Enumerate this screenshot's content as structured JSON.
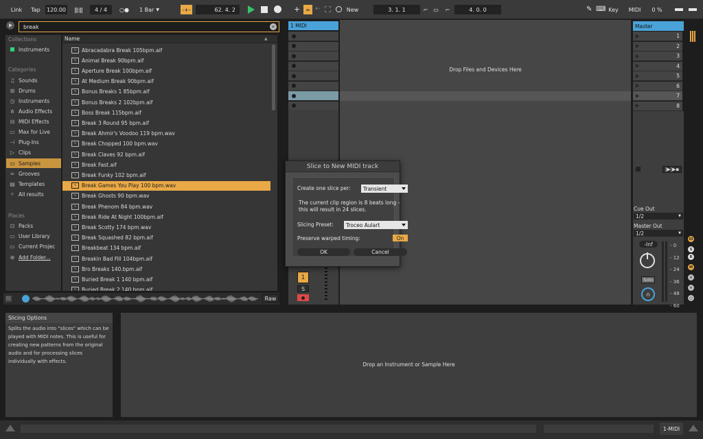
{
  "transport": {
    "link": "Link",
    "tap": "Tap",
    "tempo": "120.00",
    "meter_icon": "metronome-bars-icon",
    "time_signature": "4 / 4",
    "follow": "○●",
    "quantize": "1 Bar",
    "position": "62.  4.  2",
    "new": "New",
    "loop_start": "3.  1.  1",
    "loop_length": "4.  0.  0",
    "key": "Key",
    "midi": "MIDI",
    "cpu": "0 %"
  },
  "browser": {
    "search_value": "break",
    "collections_heading": "Collections",
    "collections": [
      {
        "label": "Instruments",
        "color": "#2fd47a"
      }
    ],
    "categories_heading": "Categories",
    "categories": [
      {
        "label": "Sounds",
        "icon": "note-icon"
      },
      {
        "label": "Drums",
        "icon": "drums-icon"
      },
      {
        "label": "Instruments",
        "icon": "clock-icon"
      },
      {
        "label": "Audio Effects",
        "icon": "audio-fx-icon"
      },
      {
        "label": "MIDI Effects",
        "icon": "midi-fx-icon"
      },
      {
        "label": "Max for Live",
        "icon": "max-icon"
      },
      {
        "label": "Plug-Ins",
        "icon": "plugin-icon"
      },
      {
        "label": "Clips",
        "icon": "clip-icon"
      },
      {
        "label": "Samples",
        "icon": "sample-icon"
      },
      {
        "label": "Grooves",
        "icon": "groove-icon"
      },
      {
        "label": "Templates",
        "icon": "template-icon"
      },
      {
        "label": "All results",
        "icon": "search-icon"
      }
    ],
    "places_heading": "Places",
    "places": [
      {
        "label": "Packs",
        "icon": "packs-icon"
      },
      {
        "label": "User Library",
        "icon": "user-icon"
      },
      {
        "label": "Current Projec",
        "icon": "project-icon"
      },
      {
        "label": "Add Folder...",
        "icon": "add-folder-icon"
      }
    ],
    "name_header": "Name",
    "files": [
      "Abracadabra Break 105bpm.aif",
      "Animal Break 90bpm.aif",
      "Aperture Break 100bpm.aif",
      "At Medium Break 90bpm.aif",
      "Bonus Breaks 1 85bpm.aif",
      "Bonus Breaks 2 102bpm.aif",
      "Boss Break 115bpm.aif",
      "Break 3 Round 95 bpm.aif",
      "Break Ahmir's Voodoo 119 bpm.wav",
      "Break Chopped 100 bpm.wav",
      "Break Claves 92 bpm.aif",
      "Break Fast.aif",
      "Break Funky 102 bpm.aif",
      "Break Games You Play 100 bpm.wav",
      "Break Ghosts 90 bpm.wav",
      "Break Phenom 84 bpm.wav",
      "Break Ride At Night 100bpm.aif",
      "Break Scotty 174 bpm.wav",
      "Break Squashed 82 bpm.aif",
      "Breakbeat 134 bpm.aif",
      "Breakin Bad Fill 104bpm.aif",
      "Bro Breaks 140.bpm.aif",
      "Buried Break 1 140 bpm.aif",
      "Buried Break 2 140 bpm.aif"
    ],
    "selected_file_index": 13,
    "preview_raw": "Raw"
  },
  "session": {
    "track_name": "1 MIDI",
    "drop_hint": "Drop Files and Devices Here",
    "track_number": "1",
    "solo": "S",
    "master_name": "Master",
    "scenes": [
      "1",
      "2",
      "3",
      "4",
      "5",
      "6",
      "7",
      "8"
    ],
    "cue_out_label": "Cue Out",
    "cue_out_value": "1/2",
    "master_out_label": "Master Out",
    "master_out_value": "1/2",
    "volume": "-Inf",
    "solo_label": "Solo",
    "meter_ticks": [
      "0",
      "12",
      "24",
      "36",
      "48",
      "60"
    ]
  },
  "info": {
    "title": "Slicing Options",
    "text": "Splits the audio into \"slices\" which can be played with MIDI notes. This is useful for creating new patterns from the original audio and for processing slices individually with effects."
  },
  "device": {
    "drop_hint": "Drop an Instrument or Sample Here"
  },
  "status": {
    "track": "1-MIDI"
  },
  "dialog": {
    "title": "Slice to New MIDI track",
    "slice_label": "Create one slice per:",
    "slice_value": "Transient",
    "message": "The current clip region is 8 beats long - this will result in 24 slices.",
    "preset_label": "Slicing Preset:",
    "preset_value": "Troceo Aulart",
    "warp_label": "Preserve warped timing:",
    "warp_value": "On",
    "ok": "OK",
    "cancel": "Cancel"
  },
  "colors": {
    "accent_orange": "#e9a946",
    "track_blue": "#4aa3d8",
    "play_green": "#38c36b",
    "record_red": "#e04848"
  }
}
